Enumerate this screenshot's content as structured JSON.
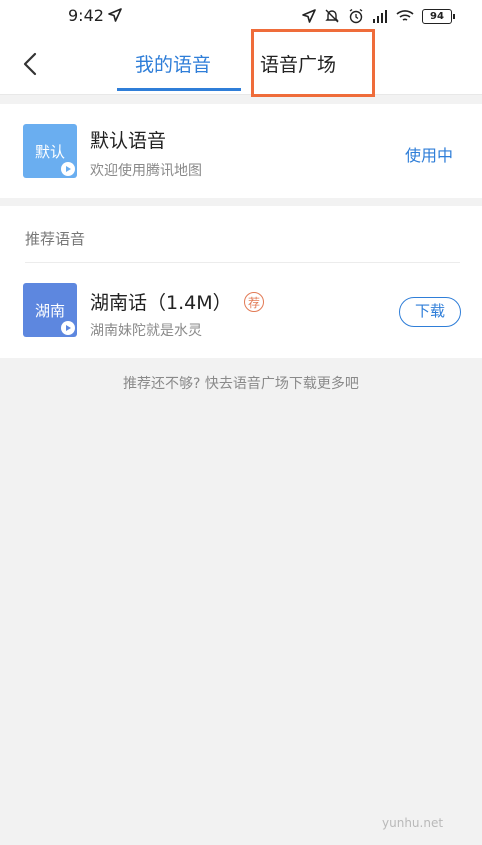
{
  "status_bar": {
    "time": "9:42",
    "battery": "94",
    "icons": [
      "navigation-arrow-icon",
      "location-icon",
      "mute-icon",
      "alarm-icon",
      "signal-icon",
      "wifi-icon",
      "battery-icon"
    ]
  },
  "header": {
    "back_icon": "chevron-left-icon",
    "tabs": [
      {
        "label": "我的语音",
        "active": true
      },
      {
        "label": "语音广场",
        "active": false
      }
    ],
    "accent_color": "#2f7ed8",
    "highlight_color": "#ef6c3a"
  },
  "current_voice": {
    "thumb_text": "默认",
    "name": "默认语音",
    "description": "欢迎使用腾讯地图",
    "status": "使用中"
  },
  "recommended": {
    "section_label": "推荐语音",
    "items": [
      {
        "thumb_text": "湖南",
        "name": "湖南话（1.4M）",
        "badge": "荐",
        "description": "湖南妹陀就是水灵",
        "action": "下载"
      }
    ]
  },
  "footer_hint": "推荐还不够? 快去语音广场下载更多吧",
  "watermark": "yunhu.net"
}
